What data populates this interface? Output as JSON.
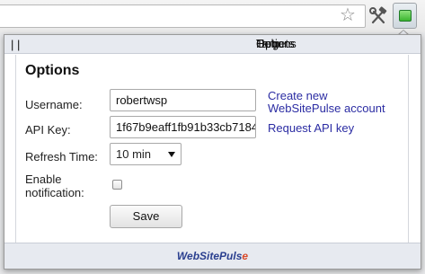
{
  "browser": {
    "bookmark_icon": "star-outline",
    "tools_icon": "hammer-wrench",
    "extension_icon": "green-square"
  },
  "nav": {
    "targets": "Targets",
    "options": "Options",
    "help": "Help",
    "separator": "|"
  },
  "options": {
    "heading": "Options",
    "username_label": "Username:",
    "username_value": "robertwsp",
    "create_account_line1": "Create new",
    "create_account_line2": "WebSitePulse account",
    "api_key_label": "API Key:",
    "api_key_value": "1f67b9eaff1fb91b33cb7184",
    "request_api_key": "Request API key",
    "refresh_label": "Refresh Time:",
    "refresh_value": "10 min",
    "notification_label_line1": "Enable",
    "notification_label_line2": "notification:",
    "notification_checked": false,
    "save_label": "Save"
  },
  "footer": {
    "brand_main": "WebSitePuls",
    "brand_end": "e"
  },
  "colors": {
    "link": "#2b2ca3",
    "brand": "#2a3f8f",
    "brand_accent": "#d94a2a",
    "ext_green": "#3bb52f"
  }
}
